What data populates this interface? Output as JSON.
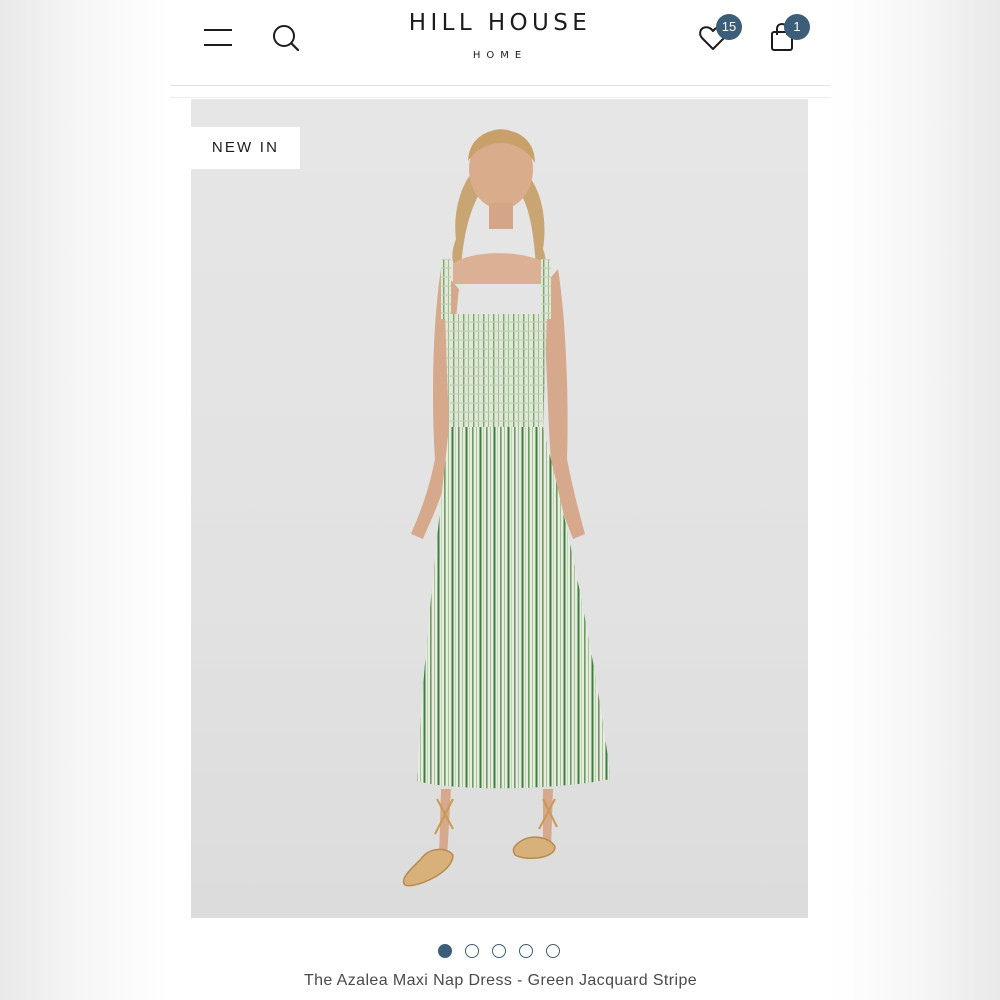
{
  "header": {
    "brand": "HILL HOUSE",
    "brand_sub": "HOME",
    "wishlist_count": "15",
    "bag_count": "1",
    "icons": {
      "menu": "hamburger-menu-icon",
      "search": "search-icon",
      "wishlist": "heart-icon",
      "bag": "shopping-bag-icon"
    },
    "accent_color": "#3d5e78"
  },
  "product": {
    "badge": "NEW IN",
    "title": "The Azalea Maxi Nap Dress - Green Jacquard Stripe",
    "image_count": "5",
    "active_image": "1"
  }
}
